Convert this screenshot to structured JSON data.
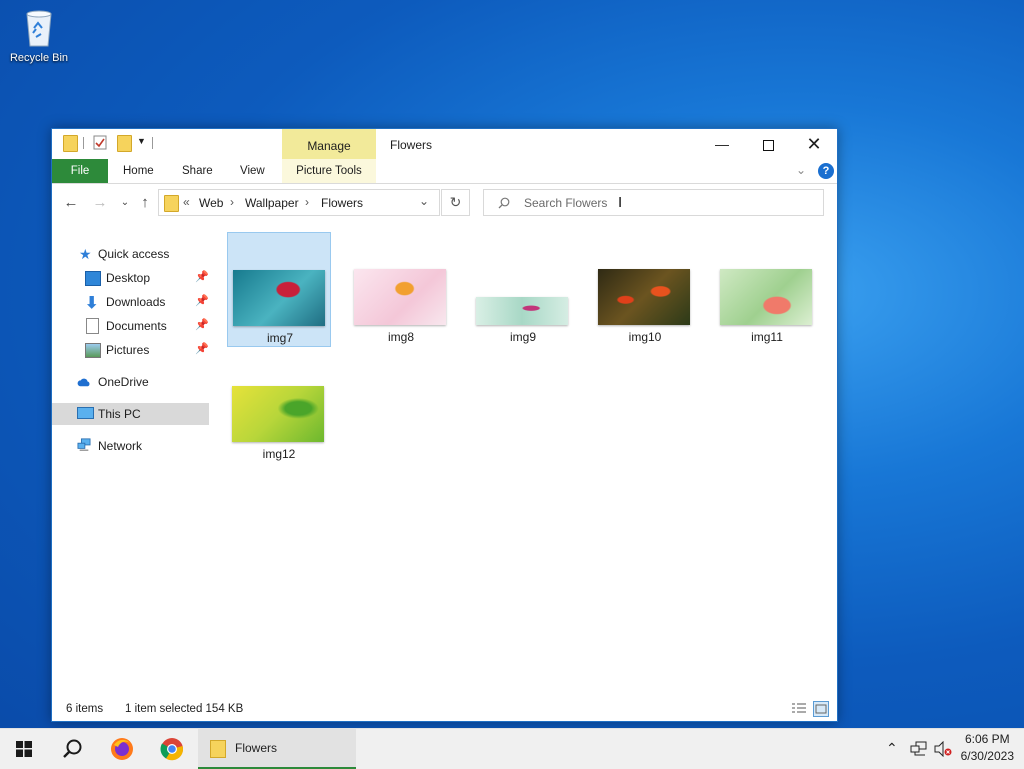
{
  "desktop": {
    "recycle_bin_label": "Recycle Bin"
  },
  "window": {
    "manage_tab": "Manage",
    "title": "Flowers",
    "ribbon_tabs": [
      "File",
      "Home",
      "Share",
      "View",
      "Picture Tools"
    ],
    "help_label": "?",
    "breadcrumb": {
      "overflow": "«",
      "items": [
        "Web",
        "Wallpaper",
        "Flowers"
      ],
      "separator": "›"
    },
    "search_placeholder": "Search Flowers",
    "nav": {
      "quick_access": "Quick access",
      "pinned": [
        "Desktop",
        "Downloads",
        "Documents",
        "Pictures"
      ],
      "onedrive": "OneDrive",
      "this_pc": "This PC",
      "network": "Network"
    },
    "files": [
      "img7",
      "img8",
      "img9",
      "img10",
      "img11",
      "img12"
    ],
    "selected_file": "img7",
    "status": {
      "count": "6 items",
      "selection": "1 item selected  154 KB"
    }
  },
  "taskbar": {
    "explorer_label": "Flowers",
    "time": "6:06 PM",
    "date": "6/30/2023",
    "accent": "#2d8a3a"
  },
  "colors": {
    "file_tab": "#2d8a3a",
    "manage_tab": "#f2ea9a",
    "selection": "#cce4f7",
    "help": "#1a6fd0"
  }
}
